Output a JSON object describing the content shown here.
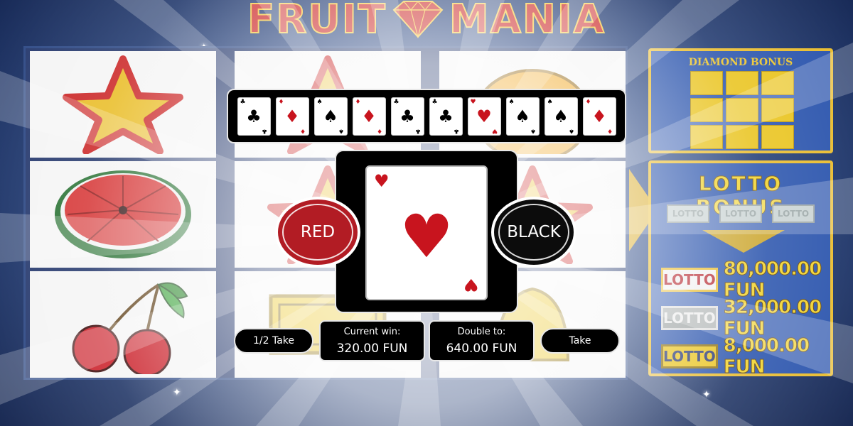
{
  "title": {
    "word_left": "FRUIT",
    "word_right": "MANIA"
  },
  "reels": {
    "symbols": [
      [
        "star-icon",
        "star-icon",
        "orange-icon"
      ],
      [
        "watermelon-icon",
        "star-icon",
        "star-icon"
      ],
      [
        "cherries-icon",
        "lotto-ticket-icon",
        "bell-icon"
      ]
    ]
  },
  "diamond_bonus": {
    "title": "DIAMOND BONUS"
  },
  "lotto_bonus": {
    "title": "LOTTO BONUS",
    "tickets": [
      "LOTTO",
      "LOTTO",
      "LOTTO"
    ],
    "prizes": [
      {
        "badge": "LOTTO",
        "amount": "80,000.00 FUN"
      },
      {
        "badge": "LOTTO",
        "amount": "32,000.00 FUN"
      },
      {
        "badge": "LOTTO",
        "amount": "8,000.00 FUN"
      }
    ]
  },
  "gamble": {
    "history": [
      {
        "suit": "♣",
        "color": "#000000"
      },
      {
        "suit": "♦",
        "color": "#c8141e"
      },
      {
        "suit": "♠",
        "color": "#000000"
      },
      {
        "suit": "♦",
        "color": "#c8141e"
      },
      {
        "suit": "♣",
        "color": "#000000"
      },
      {
        "suit": "♣",
        "color": "#000000"
      },
      {
        "suit": "♥",
        "color": "#c8141e"
      },
      {
        "suit": "♠",
        "color": "#000000"
      },
      {
        "suit": "♠",
        "color": "#000000"
      },
      {
        "suit": "♦",
        "color": "#c8141e"
      }
    ],
    "current_card": {
      "suit": "♥",
      "color": "#c8141e"
    },
    "red_label": "RED",
    "black_label": "BLACK",
    "half_take_label": "1/2 Take",
    "current_win_label": "Current win:",
    "current_win_value": "320.00 FUN",
    "double_to_label": "Double to:",
    "double_to_value": "640.00 FUN",
    "take_label": "Take"
  },
  "colors": {
    "red": "#b21c24",
    "gold": "#e8b820",
    "panel_blue": "#1e4aa8",
    "background": "#13306e"
  }
}
